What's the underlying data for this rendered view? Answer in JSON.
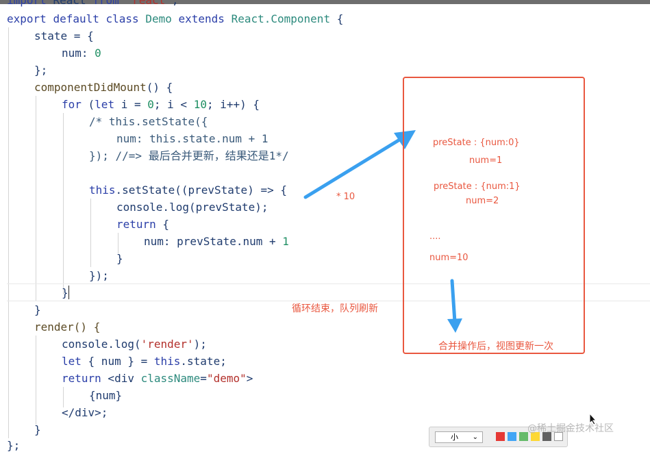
{
  "code": {
    "l0_kw1": "import",
    "l0_id": "React",
    "l0_kw2": "from",
    "l0_str": "'react'",
    "l0_end": ";",
    "l1_kw1": "export",
    "l1_kw2": "default",
    "l1_kw3": "class",
    "l1_cls": "Demo",
    "l1_kw4": "extends",
    "l1_base": "React.Component",
    "l1_end": "{",
    "l2": "state = {",
    "l3_key": "num:",
    "l3_val": "0",
    "l4": "};",
    "l5_fn": "componentDidMount",
    "l5_rest": "() {",
    "l6_kw": "for",
    "l6_a": " (",
    "l6_kw2": "let",
    "l6_b": " i = ",
    "l6_n1": "0",
    "l6_c": "; i < ",
    "l6_n2": "10",
    "l6_d": "; i++) {",
    "l7": "/* this.setState({",
    "l8": "num: this.state.num + 1",
    "l9": "}); //=> 最后合并更新，结果还是1*/",
    "l11_kw": "this",
    "l11_rest": ".setState((prevState) => {",
    "l12": "console.log(prevState);",
    "l13_kw": "return",
    "l13_rest": " {",
    "l14_a": "num: prevState.num + ",
    "l14_n": "1",
    "l15": "}",
    "l16": "});",
    "l17": "}",
    "l18": "}",
    "l19": "render() {",
    "l20_a": "console.log(",
    "l20_str": "'render'",
    "l20_b": ");",
    "l21_kw": "let",
    "l21_a": " { num } = ",
    "l21_kw2": "this",
    "l21_b": ".state;",
    "l22_kw": "return",
    "l22_a": " <div ",
    "l22_attr": "className",
    "l22_b": "=",
    "l22_str": "\"demo\"",
    "l22_c": ">",
    "l23": "{num}",
    "l24": "</div>;",
    "l25": "}",
    "l26": "};"
  },
  "annotations": {
    "times": "* 10",
    "prestate1": "preState : {num:0}",
    "num1": "num=1",
    "prestate2": "preState : {num:1}",
    "num2": "num=2",
    "ellipsis": "....",
    "num10": "num=10",
    "loop_end": "循环结束，队列刷新",
    "merge": "合并操作后，视图更新一次"
  },
  "colors": {
    "annotation": "#e9573f",
    "arrow": "#3aa0ef",
    "keyword": "#2b3fa8"
  },
  "toolbar": {
    "size_label": "小",
    "swatches": [
      "#e53935",
      "#42a5f5",
      "#66bb6a",
      "#fdd835",
      "#616161",
      "#ffffff"
    ]
  },
  "watermark": "@稀土掘金技术社区"
}
